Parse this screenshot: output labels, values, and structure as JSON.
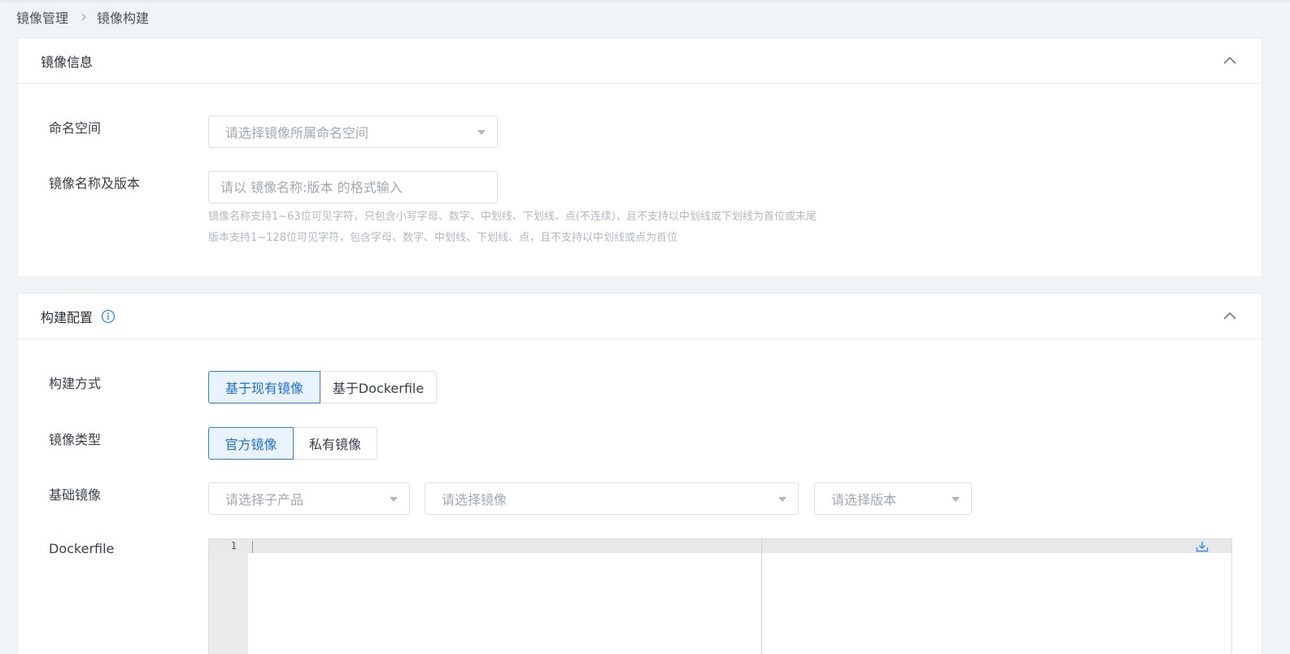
{
  "breadcrumb": {
    "parent": "镜像管理",
    "current": "镜像构建"
  },
  "image_info": {
    "title": "镜像信息",
    "namespace_label": "命名空间",
    "namespace_placeholder": "请选择镜像所属命名空间",
    "name_version_label": "镜像名称及版本",
    "name_version_placeholder": "请以 镜像名称:版本 的格式输入",
    "hint_name": "镜像名称支持1~63位可见字符，只包含小写字母、数字、中划线、下划线、点(不连续)，且不支持以中划线或下划线为首位或末尾",
    "hint_version": "版本支持1~128位可见字符，包含字母、数字、中划线、下划线、点，且不支持以中划线或点为首位"
  },
  "build_config": {
    "title": "构建配置",
    "build_method_label": "构建方式",
    "build_method_options": [
      "基于现有镜像",
      "基于Dockerfile"
    ],
    "build_method_selected": "基于现有镜像",
    "image_type_label": "镜像类型",
    "image_type_options": [
      "官方镜像",
      "私有镜像"
    ],
    "image_type_selected": "官方镜像",
    "base_image_label": "基础镜像",
    "base_image_placeholders": {
      "sub_product": "请选择子产品",
      "image": "请选择镜像",
      "version": "请选择版本"
    },
    "dockerfile_label": "Dockerfile",
    "editor_line_number": "1"
  },
  "colors": {
    "accent": "#1f6fd1",
    "accent_bg": "#e8f3ff",
    "page_bg": "#f1f4f7"
  },
  "icons": [
    "chevron-right-icon",
    "info-icon",
    "chevron-up-icon",
    "caret-down-icon",
    "download-icon"
  ]
}
